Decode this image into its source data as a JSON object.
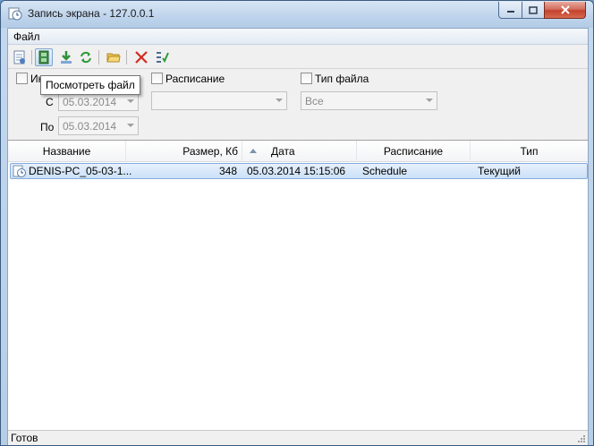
{
  "window": {
    "title": "Запись экрана - 127.0.0.1"
  },
  "menu": {
    "items": [
      "Файл"
    ]
  },
  "toolbar": {
    "tooltip": "Посмотреть файл",
    "buttons": [
      "properties-icon",
      "film-icon",
      "download-icon",
      "refresh-icon",
      "folder-icon",
      "delete-icon",
      "checklist-icon"
    ]
  },
  "filters": {
    "interval": {
      "label": "Ин",
      "checked": false,
      "from_label": "С",
      "from_value": "05.03.2014",
      "to_label": "По",
      "to_value": "05.03.2014"
    },
    "schedule": {
      "label": "Расписание",
      "checked": false,
      "value": ""
    },
    "filetype": {
      "label": "Тип файла",
      "checked": false,
      "value": "Все"
    }
  },
  "list": {
    "columns": [
      "Название",
      "Размер, Кб",
      "Дата",
      "Расписание",
      "Тип"
    ],
    "rows": [
      {
        "name": "DENIS-PC_05-03-1...",
        "size": "348",
        "date": "05.03.2014 15:15:06",
        "schedule": "Schedule",
        "type": "Текущий"
      }
    ]
  },
  "status": {
    "text": "Готов"
  },
  "colors": {
    "selection": "#cbe1f8",
    "accent": "#3c5b7f",
    "close": "#c4412c"
  }
}
